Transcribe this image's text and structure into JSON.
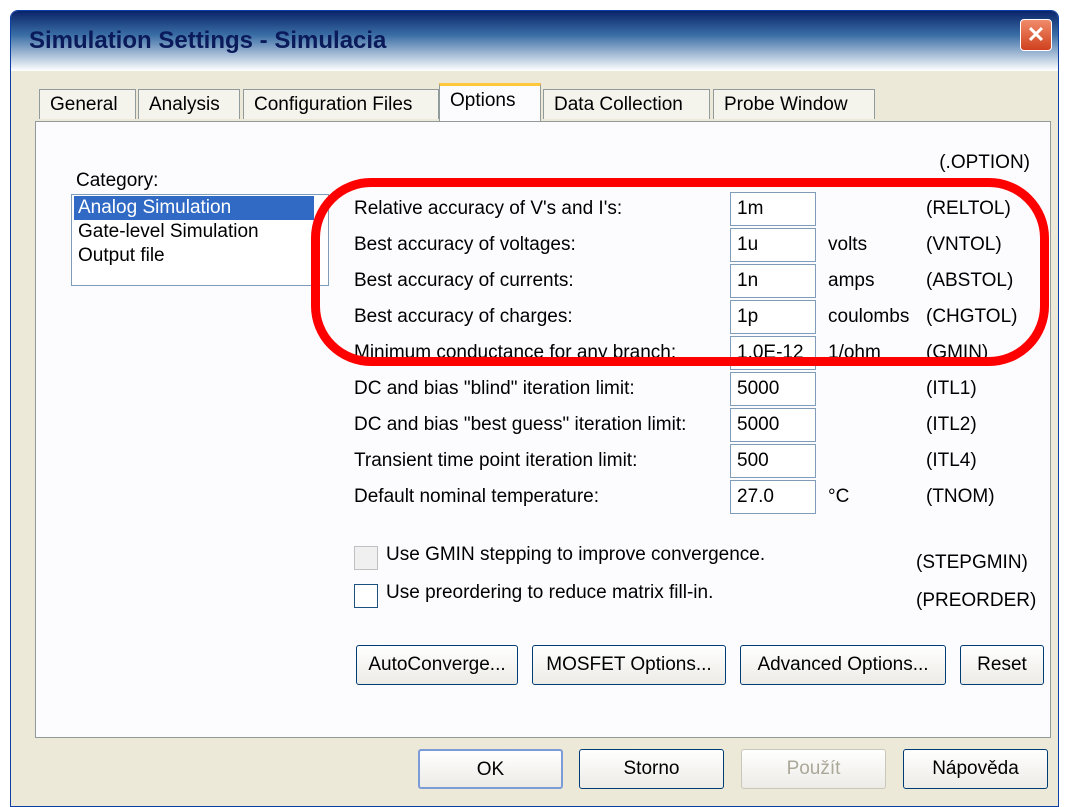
{
  "window": {
    "title": "Simulation Settings - Simulacia",
    "close_glyph": "✕"
  },
  "tabs": [
    {
      "label": "General"
    },
    {
      "label": "Analysis"
    },
    {
      "label": "Configuration Files"
    },
    {
      "label": "Options",
      "active": true
    },
    {
      "label": "Data Collection"
    },
    {
      "label": "Probe Window"
    }
  ],
  "category": {
    "label": "Category:",
    "items": [
      "Analog Simulation",
      "Gate-level Simulation",
      "Output file"
    ],
    "selected": "Analog Simulation"
  },
  "option_header": "(.OPTION)",
  "rows": [
    {
      "label": "Relative accuracy of V's and I's:",
      "value": "1m",
      "unit": "",
      "key": "(RELTOL)"
    },
    {
      "label": "Best accuracy of voltages:",
      "value": "1u",
      "unit": "volts",
      "key": "(VNTOL)"
    },
    {
      "label": "Best accuracy of currents:",
      "value": "1n",
      "unit": "amps",
      "key": "(ABSTOL)"
    },
    {
      "label": "Best accuracy of charges:",
      "value": "1p",
      "unit": "coulombs",
      "key": "(CHGTOL)"
    },
    {
      "label": "Minimum conductance for any branch:",
      "value": "1.0E-12",
      "unit": "1/ohm",
      "key": "(GMIN)"
    },
    {
      "label": "DC and bias \"blind\" iteration limit:",
      "value": "5000",
      "unit": "",
      "key": "(ITL1)"
    },
    {
      "label": "DC and bias \"best guess\" iteration limit:",
      "value": "5000",
      "unit": "",
      "key": "(ITL2)"
    },
    {
      "label": "Transient time point iteration limit:",
      "value": "500",
      "unit": "",
      "key": "(ITL4)"
    },
    {
      "label": "Default nominal temperature:",
      "value": "27.0",
      "unit": "°C",
      "key": "(TNOM)"
    }
  ],
  "checkboxes": [
    {
      "label": "Use GMIN stepping to improve convergence.",
      "key": "(STEPGMIN)",
      "checked": false,
      "enabled": false
    },
    {
      "label": "Use preordering to reduce matrix fill-in.",
      "key": "(PREORDER)",
      "checked": false,
      "enabled": true
    }
  ],
  "option_buttons": {
    "autoconverge": "AutoConverge...",
    "mosfet": "MOSFET Options...",
    "advanced": "Advanced Options...",
    "reset": "Reset"
  },
  "dialog_buttons": {
    "ok": "OK",
    "cancel": "Storno",
    "apply": "Použít",
    "help": "Nápověda"
  },
  "annotation": {
    "color": "#ff0000"
  }
}
